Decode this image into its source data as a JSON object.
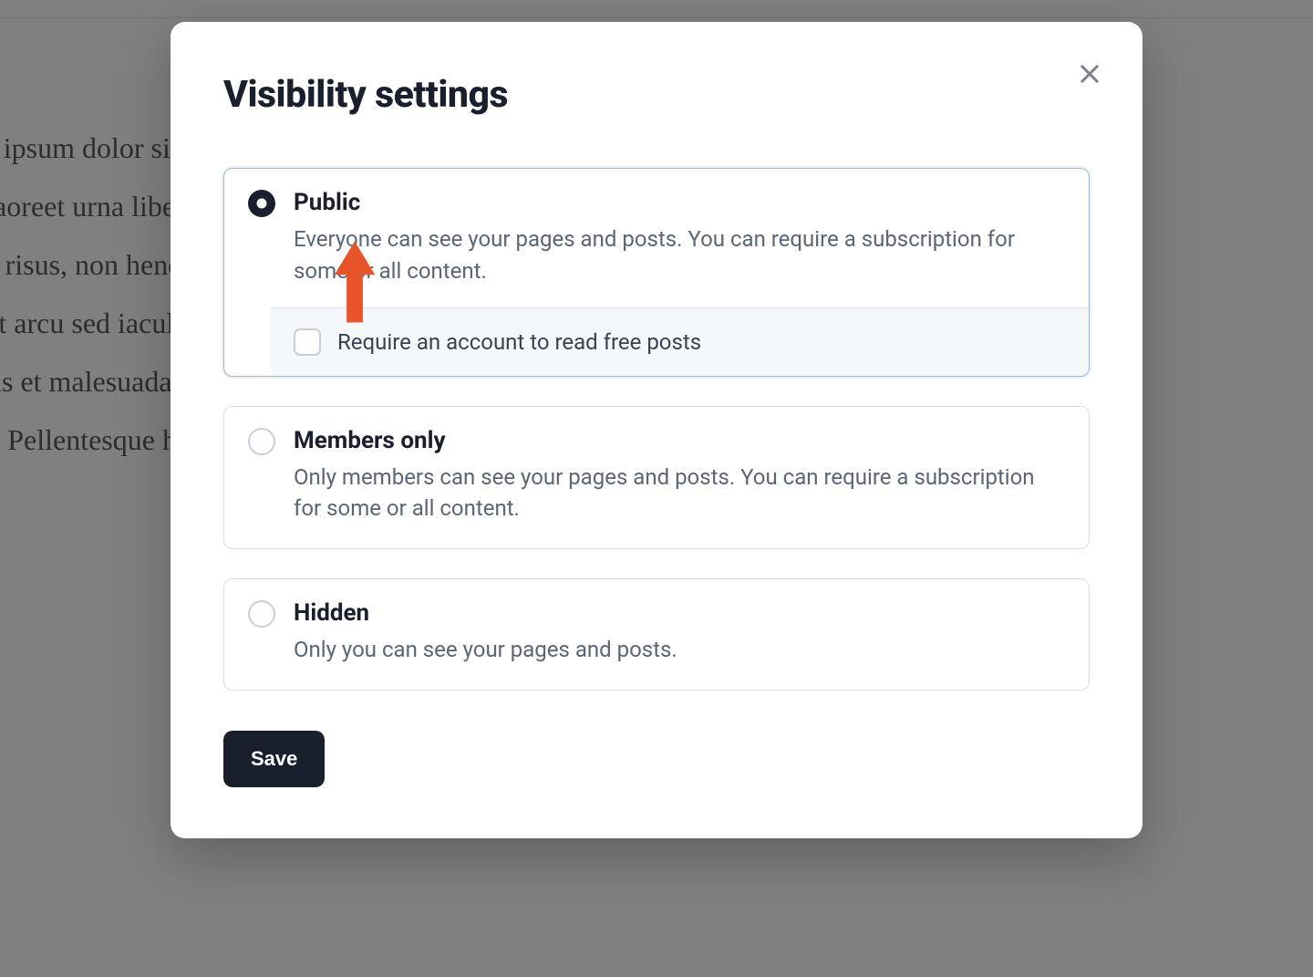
{
  "background_text": "orem ipsum dolor sit amet, consectetur adipiscing elit. Fusce commodo ultrices neq\nunc laoreet urna libero, at viverra nulla imperdiet vel. Suspendisse aliquet m\nursus risus, non hendrerit purus tristique eu. Cras commodo facilibus justo.\ngue at arcu sed iaculis. Duis consequat orci at ante convallis, ac morbi t\nt netus et malesuada fames ac turpis egestas. Fusce fermentum tem\nauris. Pellentesque habitant morbi tristique senectus et arcu mi.",
  "modal": {
    "title": "Visibility settings",
    "close_label": "Close",
    "save_label": "Save",
    "options": [
      {
        "title": "Public",
        "desc": "Everyone can see your pages and posts. You can require a subscription for some or all content.",
        "sub_label": "Require an account to read free posts"
      },
      {
        "title": "Members only",
        "desc": "Only members can see your pages and posts. You can require a subscription for some or all content."
      },
      {
        "title": "Hidden",
        "desc": "Only you can see your pages and posts."
      }
    ]
  }
}
